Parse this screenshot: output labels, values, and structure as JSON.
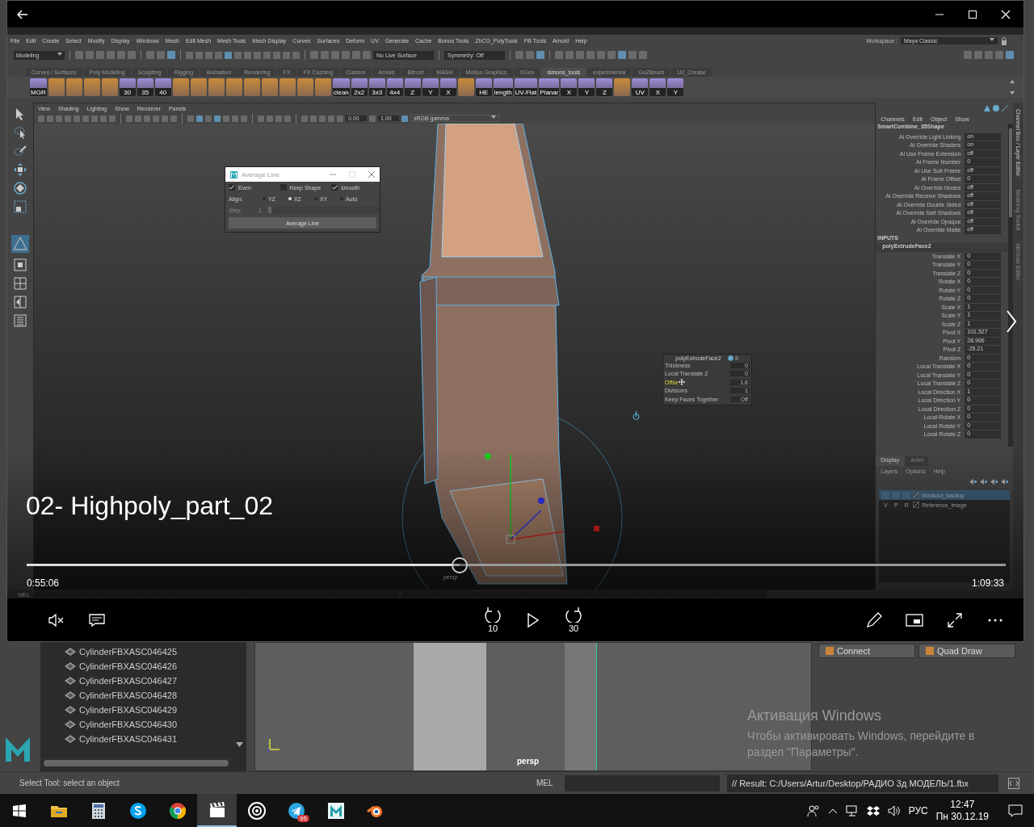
{
  "player": {
    "maya": {
      "menus": [
        "File",
        "Edit",
        "Create",
        "Select",
        "Modify",
        "Display",
        "Windows",
        "Mesh",
        "Edit Mesh",
        "Mesh Tools",
        "Mesh Display",
        "Curves",
        "Surfaces",
        "Deform",
        "UV",
        "Generate",
        "Cache",
        "Bonus Tools",
        "ZhCG_PolyTools",
        "FB Tools",
        "Arnold",
        "Help"
      ],
      "workspace_label": "Workspace :",
      "workspace": "Maya Classic",
      "mode": "Modeling",
      "live_surface": "No Live Surface",
      "symmetry": "Symmetry: Off",
      "shelf_tabs": [
        {
          "label": "Curves / Surfaces",
          "selected": false
        },
        {
          "label": "Poly Modeling",
          "selected": false
        },
        {
          "label": "Sculpting",
          "selected": false
        },
        {
          "label": "Rigging",
          "selected": false
        },
        {
          "label": "Animation",
          "selected": false
        },
        {
          "label": "Rendering",
          "selected": false
        },
        {
          "label": "FX",
          "selected": false
        },
        {
          "label": "FX Caching",
          "selected": false
        },
        {
          "label": "Custom",
          "selected": false
        },
        {
          "label": "Arnold",
          "selected": false
        },
        {
          "label": "Bifrost",
          "selected": false
        },
        {
          "label": "MASH",
          "selected": false
        },
        {
          "label": "Motion Graphics",
          "selected": false
        },
        {
          "label": "XGen",
          "selected": false
        },
        {
          "label": "simons_tools",
          "selected": true
        },
        {
          "label": "experimental",
          "selected": false
        },
        {
          "label": "GoZBrush",
          "selected": false
        },
        {
          "label": "U2_Crease",
          "selected": false
        }
      ],
      "shelf_buttons": [
        {
          "kind": "labeled",
          "label": "MGR"
        },
        {
          "kind": "icon"
        },
        {
          "kind": "icon"
        },
        {
          "kind": "icon"
        },
        {
          "kind": "icon"
        },
        {
          "kind": "labeled",
          "label": "30"
        },
        {
          "kind": "labeled",
          "label": "35"
        },
        {
          "kind": "labeled",
          "label": "40"
        },
        {
          "kind": "icon"
        },
        {
          "kind": "icon"
        },
        {
          "kind": "icon"
        },
        {
          "kind": "icon"
        },
        {
          "kind": "icon"
        },
        {
          "kind": "icon"
        },
        {
          "kind": "icon"
        },
        {
          "kind": "icon"
        },
        {
          "kind": "icon"
        },
        {
          "kind": "labeled",
          "label": "clean"
        },
        {
          "kind": "labeled",
          "label": "2x2"
        },
        {
          "kind": "labeled",
          "label": "3x3"
        },
        {
          "kind": "labeled",
          "label": "4x4"
        },
        {
          "kind": "labeled",
          "label": "Z"
        },
        {
          "kind": "labeled",
          "label": "Y"
        },
        {
          "kind": "labeled",
          "label": "X"
        },
        {
          "kind": "icon"
        },
        {
          "kind": "labeled",
          "label": "HE"
        },
        {
          "kind": "labeled",
          "label": "length"
        },
        {
          "kind": "labeled",
          "label": "UV-Flat"
        },
        {
          "kind": "labeled",
          "label": "Planar"
        },
        {
          "kind": "labeled",
          "label": "X"
        },
        {
          "kind": "labeled",
          "label": "Y"
        },
        {
          "kind": "labeled",
          "label": "Z"
        },
        {
          "kind": "icon"
        },
        {
          "kind": "labeled",
          "label": "UV"
        },
        {
          "kind": "labeled",
          "label": "X"
        },
        {
          "kind": "labeled",
          "label": "Y"
        }
      ],
      "viewport_menus": [
        "View",
        "Shading",
        "Lighting",
        "Show",
        "Renderer",
        "Panels"
      ],
      "exposure": "0.00",
      "gamma": "1.00",
      "color_space": "sRGB gamma",
      "average_line": {
        "title": "Average Line",
        "options": [
          {
            "label": "Even",
            "checked": true
          },
          {
            "label": "Keep Shape",
            "checked": false
          },
          {
            "label": "smooth",
            "checked": true
          }
        ],
        "align_label": "Align:",
        "align": [
          {
            "label": "YZ",
            "selected": false
          },
          {
            "label": "XZ",
            "selected": true
          },
          {
            "label": "XY",
            "selected": false
          },
          {
            "label": "Auto",
            "selected": false
          }
        ],
        "step_label": "Step:",
        "step_value": "1",
        "step_disabled": true,
        "button": "Average Line"
      },
      "extrude_popup": {
        "title": "polyExtrudeFace2",
        "rows": [
          {
            "label": "Thickness",
            "value": "0",
            "highlighted": false
          },
          {
            "label": "Local Translate Z",
            "value": "0",
            "highlighted": false
          },
          {
            "label": "Offse",
            "value": "1.6",
            "highlighted": true
          },
          {
            "label": "Divisions",
            "value": "1",
            "highlighted": false
          },
          {
            "label": "Keep Faces Together",
            "value": "Off",
            "highlighted": false
          }
        ]
      },
      "camera_label": "persp",
      "channel_box": {
        "menus": [
          "Channels",
          "Edit",
          "Object",
          "Show"
        ],
        "node": "SmartCombine_35Shape",
        "shape_attrs": [
          {
            "label": "Ai Override Light Linking",
            "value": "on"
          },
          {
            "label": "Ai Override Shaders",
            "value": "on"
          },
          {
            "label": "Ai Use Frame Extension",
            "value": "off"
          },
          {
            "label": "Ai Frame Number",
            "value": "0"
          },
          {
            "label": "Ai Use Sub Frame",
            "value": "off"
          },
          {
            "label": "Ai Frame Offset",
            "value": "0"
          },
          {
            "label": "Ai Override Nodes",
            "value": "off"
          },
          {
            "label": "Ai Override Receive Shadows",
            "value": "off"
          },
          {
            "label": "Ai Override Double Sided",
            "value": "off"
          },
          {
            "label": "Ai Override Self Shadows",
            "value": "off"
          },
          {
            "label": "Ai Override Opaque",
            "value": "off"
          },
          {
            "label": "Ai Override Matte",
            "value": "off"
          }
        ],
        "inputs_header": "INPUTS",
        "input_node": "polyExtrudeFace2",
        "input_attrs": [
          {
            "label": "Translate X",
            "value": "0"
          },
          {
            "label": "Translate Y",
            "value": "0"
          },
          {
            "label": "Translate Z",
            "value": "0"
          },
          {
            "label": "Rotate X",
            "value": "0"
          },
          {
            "label": "Rotate Y",
            "value": "0"
          },
          {
            "label": "Rotate Z",
            "value": "0"
          },
          {
            "label": "Scale X",
            "value": "1"
          },
          {
            "label": "Scale Y",
            "value": "1"
          },
          {
            "label": "Scale Z",
            "value": "1"
          },
          {
            "label": "Pivot X",
            "value": "101.527"
          },
          {
            "label": "Pivot Y",
            "value": "28.966"
          },
          {
            "label": "Pivot Z",
            "value": "-25.21"
          },
          {
            "label": "Random",
            "value": "0"
          },
          {
            "label": "Local Translate X",
            "value": "0"
          },
          {
            "label": "Local Translate Y",
            "value": "0"
          },
          {
            "label": "Local Translate Z",
            "value": "0"
          },
          {
            "label": "Local Direction X",
            "value": "1"
          },
          {
            "label": "Local Direction Y",
            "value": "0"
          },
          {
            "label": "Local Direction Z",
            "value": "0"
          },
          {
            "label": "Local Rotate X",
            "value": "0"
          },
          {
            "label": "Local Rotate Y",
            "value": "0"
          },
          {
            "label": "Local Rotate Z",
            "value": "0"
          }
        ]
      },
      "layer_editor": {
        "tabs": [
          {
            "label": "Display",
            "selected": true
          },
          {
            "label": "Anim",
            "selected": false
          }
        ],
        "menus": [
          "Layers",
          "Options",
          "Help"
        ],
        "layers": [
          {
            "name": "blockout_backup",
            "selected": true
          },
          {
            "name": "Reference_image",
            "selected": false,
            "flags": [
              "V",
              "P",
              "R"
            ]
          }
        ]
      },
      "side_tabs": [
        "Channel Box / Layer Editor",
        "Modeling Toolkit",
        "Attribute Editor"
      ],
      "cmd_label": "MEL"
    },
    "overlay": {
      "title": "02- Highpoly_part_02",
      "elapsed": "0:55:06",
      "total": "1:09:33",
      "level": 0.442
    },
    "skip_back": "10",
    "skip_forward": "30"
  },
  "outliner": {
    "items": [
      "CylinderFBXASC046425",
      "CylinderFBXASC046426",
      "CylinderFBXASC046427",
      "CylinderFBXASC046428",
      "CylinderFBXASC046429",
      "CylinderFBXASC046430",
      "CylinderFBXASC046431"
    ]
  },
  "viewport": {
    "camera": "persp"
  },
  "modeling_toolkit": {
    "buttons": [
      "Connect",
      "Quad Draw"
    ]
  },
  "activation": {
    "title": "Активация Windows",
    "text": "Чтобы активировать Windows, перейдите в раздел \"Параметры\"."
  },
  "status_line": {
    "help": "Select Tool: select an object",
    "cmd_label": "MEL",
    "result": "// Result: C:/Users/Artur/Desktop/РАДИО 3д МОДЕЛЬ/1.fbx"
  },
  "taskbar": {
    "apps": [
      {
        "kind": "explorer",
        "active": false
      },
      {
        "kind": "calculator",
        "active": false
      },
      {
        "kind": "skype",
        "active": false
      },
      {
        "kind": "chrome",
        "active": false
      },
      {
        "kind": "video",
        "active": true
      },
      {
        "kind": "obs",
        "active": false
      },
      {
        "kind": "telegram",
        "active": false,
        "badge": "95"
      },
      {
        "kind": "maya",
        "active": false
      },
      {
        "kind": "blender",
        "active": false
      }
    ],
    "language": "РУС",
    "time": "12:47",
    "date": "Пн 30.12.19"
  }
}
